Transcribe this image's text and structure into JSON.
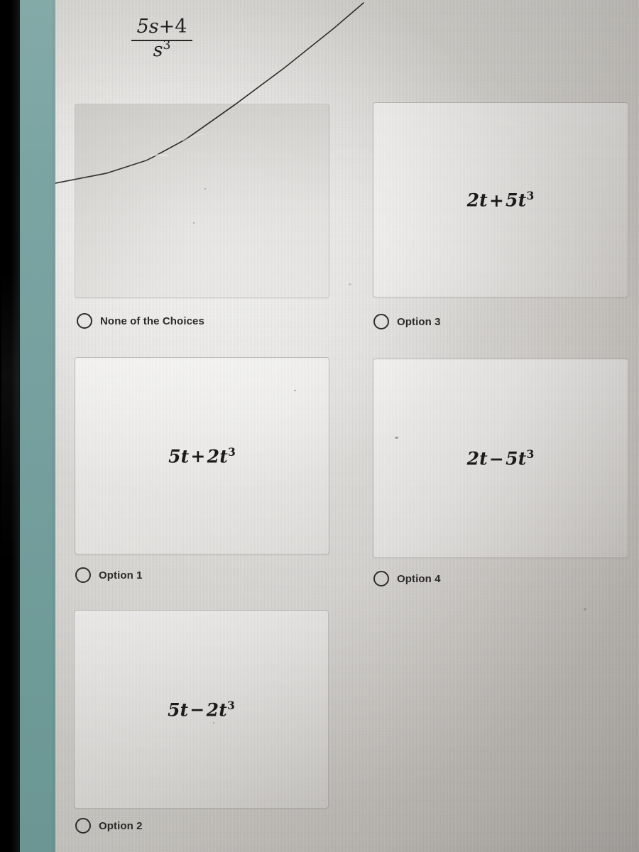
{
  "device": {
    "bezel_color": "#000000",
    "page_margin_color": "#76a09f",
    "surface_color": "#d2d0cb"
  },
  "question": {
    "expression": "(5s + 4)/s^3",
    "numerator": "5s + 4",
    "numerator_coefficient": "5",
    "numerator_variable": "s",
    "numerator_operator": "+",
    "numerator_constant": "4",
    "denominator_variable": "s",
    "denominator_exponent": "3"
  },
  "answers": [
    {
      "id": "none-of-the-choices",
      "expression": "",
      "label": "None of the Choices",
      "selected": false,
      "box_empty": true
    },
    {
      "id": "option-3",
      "expression": "2t + 5t^3",
      "term1_coefficient": "2",
      "term1_variable": "t",
      "operator": "+",
      "term2_coefficient": "5",
      "term2_variable": "t",
      "term2_exponent": "3",
      "label": "Option 3",
      "selected": false,
      "box_empty": false
    },
    {
      "id": "option-1",
      "expression": "5t + 2t^3",
      "term1_coefficient": "5",
      "term1_variable": "t",
      "operator": "+",
      "term2_coefficient": "2",
      "term2_variable": "t",
      "term2_exponent": "3",
      "label": "Option 1",
      "selected": false,
      "box_empty": false
    },
    {
      "id": "option-4",
      "expression": "2t - 5t^3",
      "term1_coefficient": "2",
      "term1_variable": "t",
      "operator": "−",
      "term2_coefficient": "5",
      "term2_variable": "t",
      "term2_exponent": "3",
      "label": "Option 4",
      "selected": false,
      "box_empty": false
    },
    {
      "id": "option-2",
      "expression": "5t - 2t^3",
      "term1_coefficient": "5",
      "term1_variable": "t",
      "operator": "−",
      "term2_coefficient": "2",
      "term2_variable": "t",
      "term2_exponent": "3",
      "label": "Option 2",
      "selected": false,
      "box_empty": false
    }
  ]
}
